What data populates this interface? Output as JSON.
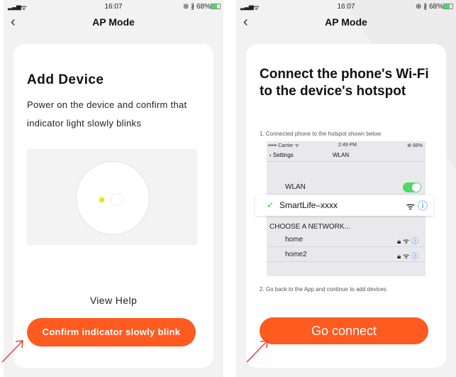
{
  "colors": {
    "accent": "#ff5a1f",
    "toggle_on": "#4cd964",
    "link_blue": "#1f7bf2",
    "arrow": "#e8413c"
  },
  "left_screen": {
    "status": {
      "time": "16:07",
      "right": "⊕ ∦ 68%"
    },
    "nav": {
      "back_icon": "chevron-left-icon",
      "title": "AP Mode"
    },
    "card": {
      "title": "Add Device",
      "description": "Power on the device and confirm that indicator light slowly blinks",
      "view_help": "View Help",
      "confirm_button": "Confirm indicator slowly blink"
    }
  },
  "right_screen": {
    "status": {
      "time": "16:07",
      "right": "⊕ ∦ 68%"
    },
    "nav": {
      "back_icon": "chevron-left-icon",
      "title": "AP Mode"
    },
    "card": {
      "title": "Connect the phone's Wi-Fi to the device's hotspot",
      "step1": "1. Connected phone to the hotspot shown below",
      "wlan_screenshot": {
        "status_left": "••••• Carrier ᯤ",
        "status_time": "2:49 PM",
        "status_right": "⊕ 68%",
        "back_label": "Settings",
        "nav_title": "WLAN",
        "wlan_label": "WLAN",
        "selected_network": "SmartLife–xxxx",
        "choose_header": "CHOOSE A NETWORK...",
        "networks": [
          "home",
          "home2"
        ]
      },
      "step2": "2. Go back to the App and continue to add devices",
      "go_button": "Go connect"
    }
  }
}
